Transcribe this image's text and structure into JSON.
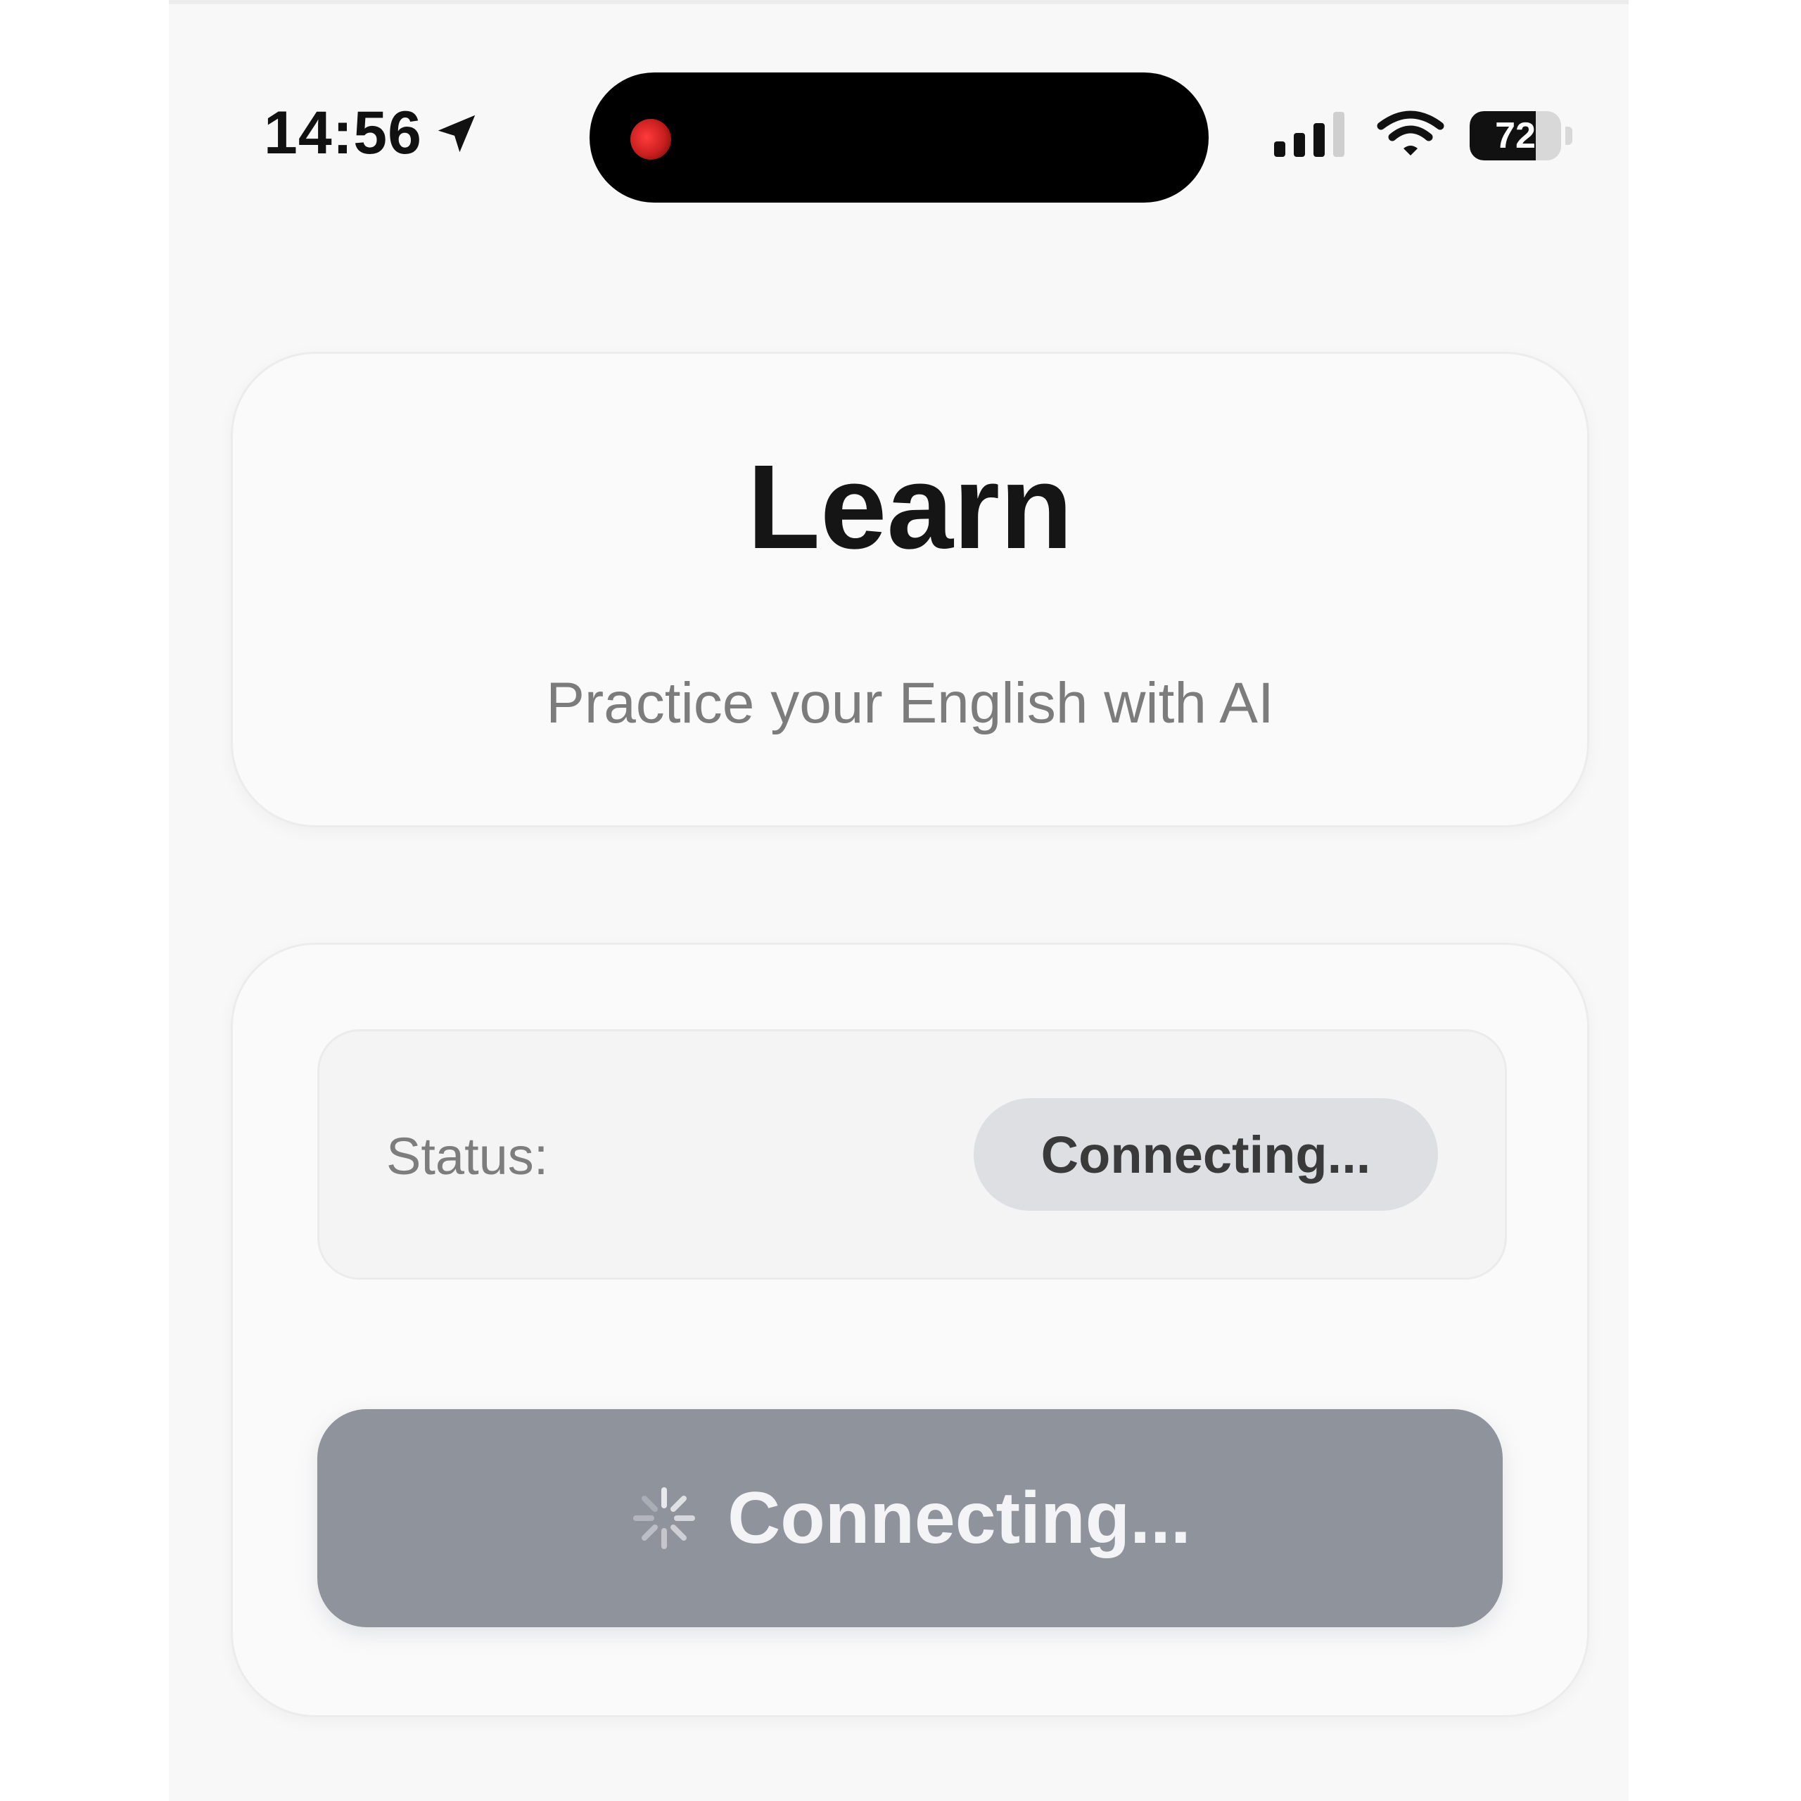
{
  "status_bar": {
    "time": "14:56",
    "location_icon": "location-arrow-icon",
    "signal_icon": "cellular-signal-icon",
    "wifi_icon": "wifi-icon",
    "battery_level": "72",
    "recording_indicator": "red"
  },
  "header": {
    "title": "Learn",
    "subtitle": "Practice your English with AI"
  },
  "status": {
    "label": "Status:",
    "value": "Connecting..."
  },
  "connect_button": {
    "label": "Connecting...",
    "icon": "spinner-icon",
    "color": "#8e939c"
  },
  "colors": {
    "background": "#f8f8f8",
    "title": "#151515",
    "subtitle": "#7c7c7c",
    "badge": "#dedfe2"
  }
}
